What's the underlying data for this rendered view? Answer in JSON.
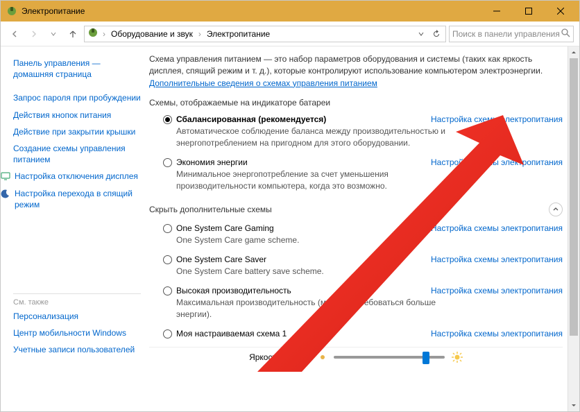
{
  "window": {
    "title": "Электропитание"
  },
  "breadcrumbs": {
    "item1": "Оборудование и звук",
    "item2": "Электропитание"
  },
  "search": {
    "placeholder": "Поиск в панели управления"
  },
  "sidebar": {
    "home": "Панель управления — домашняя страница",
    "links": [
      "Запрос пароля при пробуждении",
      "Действия кнопок питания",
      "Действие при закрытии крышки",
      "Создание схемы управления питанием",
      "Настройка отключения дисплея",
      "Настройка перехода в спящий режим"
    ],
    "see_also_label": "См. также",
    "see_also": [
      "Персонализация",
      "Центр мобильности Windows",
      "Учетные записи пользователей"
    ]
  },
  "intro": {
    "text_pre": "Схема управления питанием — это набор параметров оборудования и системы (таких как яркость дисплея, спящий режим и т. д.), которые контролируют использование компьютером электроэнергии. ",
    "link": "Дополнительные сведения о схемах управления питанием"
  },
  "sections": {
    "shown": "Схемы, отображаемые на индикаторе батареи",
    "hidden": "Скрыть дополнительные схемы"
  },
  "plans": {
    "configure": "Настройка схемы электропитания",
    "shown": [
      {
        "name": "Сбалансированная (рекомендуется)",
        "desc": "Автоматическое соблюдение баланса между производительностью и энергопотреблением на пригодном для этого оборудовании.",
        "selected": true
      },
      {
        "name": "Экономия энергии",
        "desc": "Минимальное энергопотребление за счет уменьшения производительности компьютера, когда это возможно.",
        "selected": false
      }
    ],
    "hidden": [
      {
        "name": "One System Care Gaming",
        "desc": "One System Care game scheme.",
        "selected": false
      },
      {
        "name": "One System Care Saver",
        "desc": "One System Care battery save scheme.",
        "selected": false
      },
      {
        "name": "Высокая производительность",
        "desc": "Максимальная производительность (может потребоваться больше энергии).",
        "selected": false
      },
      {
        "name": "Моя настраиваемая схема 1",
        "desc": "",
        "selected": false
      }
    ]
  },
  "brightness": {
    "label": "Яркость экрана:",
    "percent": 80
  }
}
